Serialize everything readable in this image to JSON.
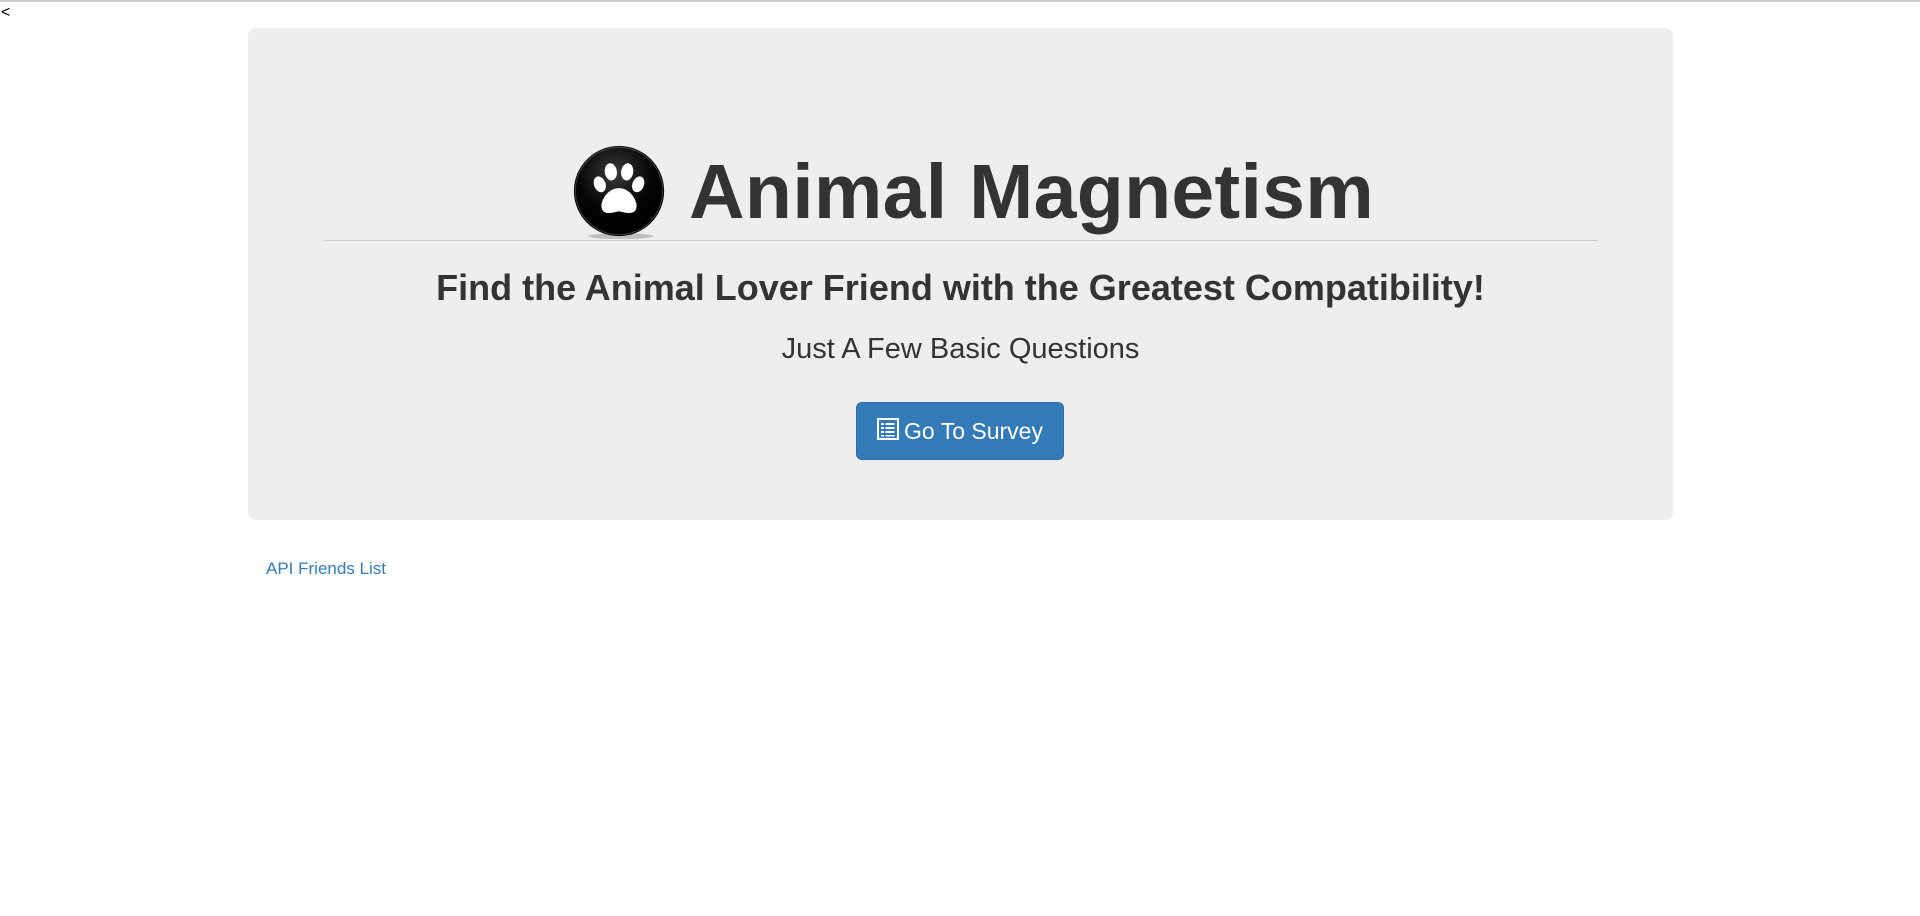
{
  "page": {
    "stray_char": "<"
  },
  "jumbotron": {
    "title": "Animal Magnetism",
    "logo_icon": "paw-print-icon",
    "subtitle": "Find the Animal Lover Friend with the Greatest Compatibility!",
    "tagline": "Just A Few Basic Questions",
    "survey_button": {
      "label": "Go To Survey",
      "icon": "list-alt-icon"
    }
  },
  "links": {
    "api_friends": "API Friends List"
  },
  "colors": {
    "jumbotron_bg": "#eeeeee",
    "primary_button": "#337ab7",
    "link": "#337ab7",
    "text": "#333333"
  }
}
